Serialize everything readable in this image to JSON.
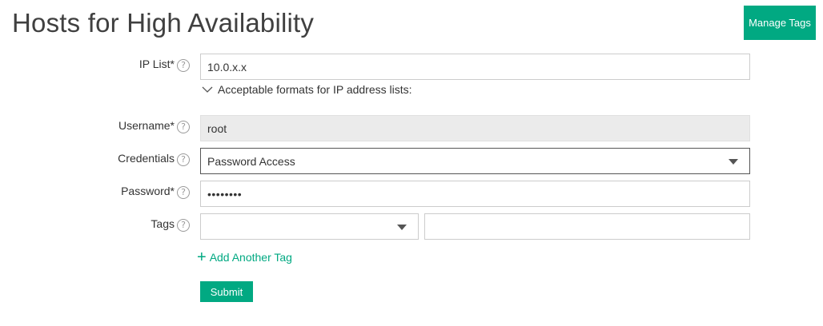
{
  "page": {
    "title": "Hosts for High Availability",
    "manage_tags_label": "Manage Tags"
  },
  "form": {
    "ip_list": {
      "label": "IP List*",
      "value": "10.0.x.x",
      "formats_toggle": "Acceptable formats for IP address lists:"
    },
    "username": {
      "label": "Username*",
      "value": "root"
    },
    "credentials": {
      "label": "Credentials",
      "selected": "Password Access"
    },
    "password": {
      "label": "Password*",
      "value": "••••••••"
    },
    "tags": {
      "label": "Tags",
      "tag_value": "",
      "add_another": "Add Another Tag"
    },
    "submit_label": "Submit",
    "help_glyph": "?"
  },
  "colors": {
    "accent": "#01a982",
    "disabled_field": "#ebebeb",
    "border": "#cccccc"
  }
}
